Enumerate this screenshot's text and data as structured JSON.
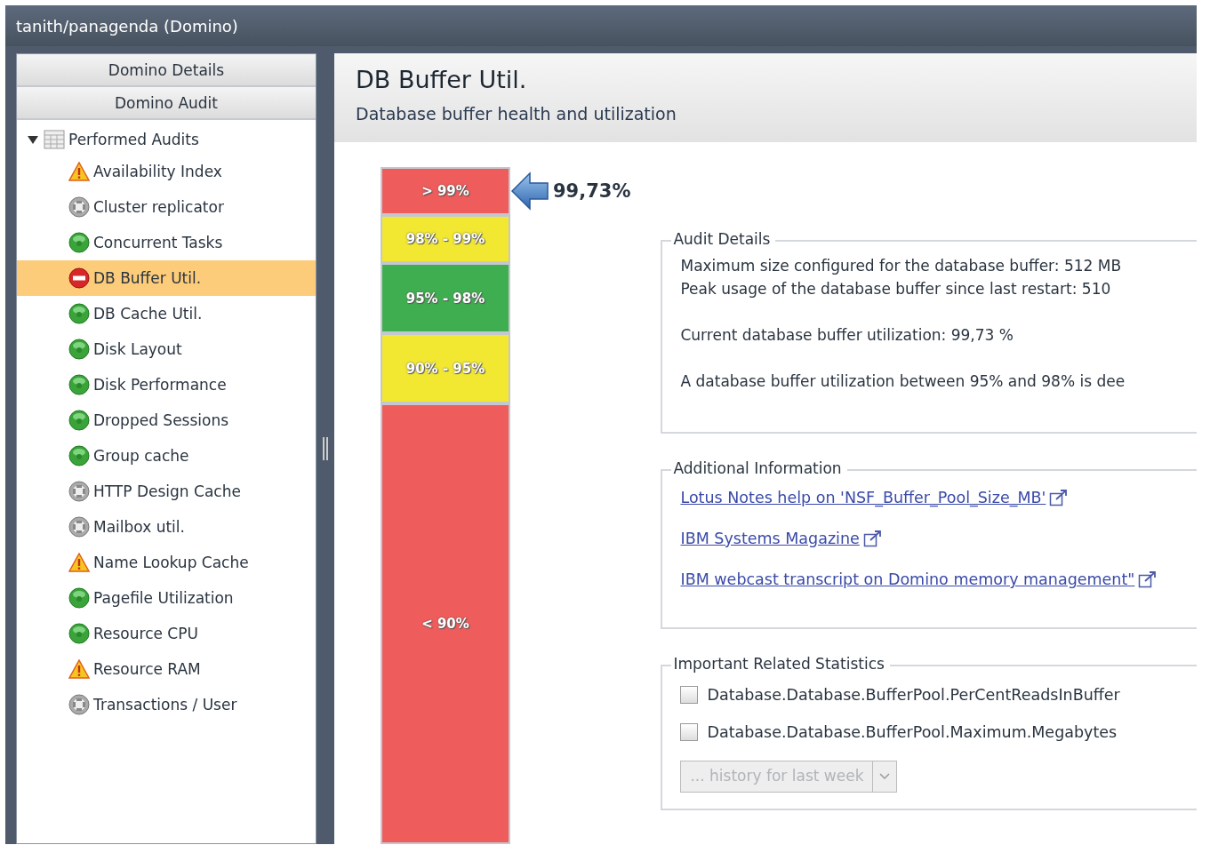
{
  "window": {
    "title": "tanith/panagenda (Domino)"
  },
  "sidebar": {
    "sections": [
      {
        "label": "Domino Details"
      },
      {
        "label": "Domino Audit"
      }
    ],
    "tree": {
      "label": "Performed Audits",
      "expanded": true,
      "children": [
        {
          "label": "Availability Index",
          "kind": "warning",
          "selected": false
        },
        {
          "label": "Cluster replicator",
          "kind": "unknown",
          "selected": false
        },
        {
          "label": "Concurrent Tasks",
          "kind": "ok",
          "selected": false
        },
        {
          "label": "DB Buffer Util.",
          "kind": "error",
          "selected": true
        },
        {
          "label": "DB Cache Util.",
          "kind": "ok",
          "selected": false
        },
        {
          "label": "Disk Layout",
          "kind": "ok",
          "selected": false
        },
        {
          "label": "Disk Performance",
          "kind": "ok",
          "selected": false
        },
        {
          "label": "Dropped Sessions",
          "kind": "ok",
          "selected": false
        },
        {
          "label": "Group cache",
          "kind": "ok",
          "selected": false
        },
        {
          "label": "HTTP Design Cache",
          "kind": "unknown",
          "selected": false
        },
        {
          "label": "Mailbox util.",
          "kind": "unknown",
          "selected": false
        },
        {
          "label": "Name Lookup Cache",
          "kind": "warning",
          "selected": false
        },
        {
          "label": "Pagefile Utilization",
          "kind": "ok",
          "selected": false
        },
        {
          "label": "Resource CPU",
          "kind": "ok",
          "selected": false
        },
        {
          "label": "Resource RAM",
          "kind": "warning",
          "selected": false
        },
        {
          "label": "Transactions / User",
          "kind": "unknown",
          "selected": false
        }
      ]
    }
  },
  "header": {
    "title": "DB Buffer Util.",
    "subtitle": "Database buffer health and utilization"
  },
  "scale": {
    "value": "99,73%",
    "segments": [
      {
        "label": "> 99%",
        "color": "#ee5c5c",
        "current": true
      },
      {
        "label": "98% - 99%",
        "color": "#f2e832",
        "current": false
      },
      {
        "label": "95% - 98%",
        "color": "#3fae50",
        "current": false
      },
      {
        "label": "90% - 95%",
        "color": "#f2e832",
        "current": false
      },
      {
        "label": "< 90%",
        "color": "#ee5c5c",
        "current": false
      }
    ]
  },
  "audit_details": {
    "title": "Audit Details",
    "paragraphs": [
      [
        "Maximum size configured for the database buffer: 512 MB",
        "Peak usage of the database buffer since last restart: 510"
      ],
      [
        "Current database buffer utilization: 99,73 %"
      ],
      [
        "A database buffer utilization between 95% and 98% is dee"
      ]
    ]
  },
  "additional_information": {
    "title": "Additional Information",
    "links": [
      "Lotus Notes help on 'NSF_Buffer_Pool_Size_MB'",
      "IBM Systems Magazine",
      "IBM webcast transcript on Domino memory management\""
    ]
  },
  "related_statistics": {
    "title": "Important Related Statistics",
    "items": [
      {
        "label": "Database.Database.BufferPool.PerCentReadsInBuffer",
        "checked": false
      },
      {
        "label": "Database.Database.BufferPool.Maximum.Megabytes",
        "checked": false
      }
    ],
    "history": {
      "kind": "select",
      "value": "... history for last week",
      "disabled": true
    }
  }
}
